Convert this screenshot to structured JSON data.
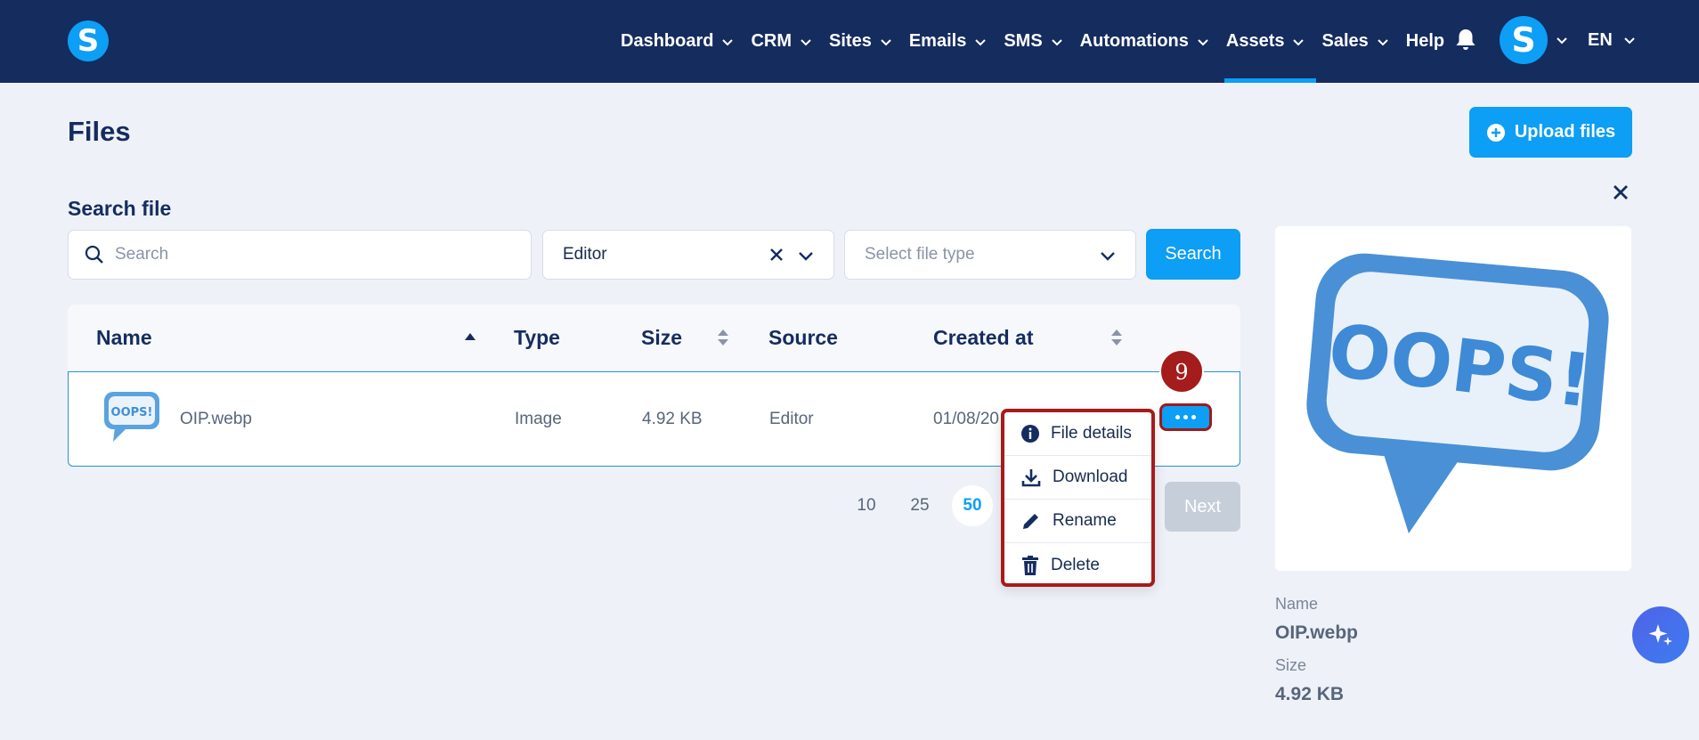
{
  "nav": {
    "logo_letter": "S",
    "items": [
      {
        "label": "Dashboard"
      },
      {
        "label": "CRM"
      },
      {
        "label": "Sites"
      },
      {
        "label": "Emails"
      },
      {
        "label": "SMS"
      },
      {
        "label": "Automations"
      },
      {
        "label": "Assets"
      },
      {
        "label": "Sales"
      }
    ],
    "help": "Help",
    "avatar_letter": "S",
    "language": "EN",
    "active_item": "Assets"
  },
  "page": {
    "title": "Files",
    "upload_label": "Upload files"
  },
  "search": {
    "section_label": "Search file",
    "placeholder": "Search",
    "source_value": "Editor",
    "type_placeholder": "Select file type",
    "button_label": "Search"
  },
  "table": {
    "headers": [
      "Name",
      "Type",
      "Size",
      "Source",
      "Created at"
    ],
    "rows": [
      {
        "name": "OIP.webp",
        "type": "Image",
        "size": "4.92 KB",
        "source": "Editor",
        "created_at": "01/08/20"
      }
    ]
  },
  "pagination": {
    "sizes": [
      "10",
      "25",
      "50"
    ],
    "current": "50",
    "next_label": "Next"
  },
  "row_menu": {
    "items": [
      {
        "label": "File details",
        "icon": "info-icon"
      },
      {
        "label": "Download",
        "icon": "download-icon"
      },
      {
        "label": "Rename",
        "icon": "pencil-icon"
      },
      {
        "label": "Delete",
        "icon": "trash-icon"
      }
    ]
  },
  "annotation": {
    "step_number": "9"
  },
  "preview": {
    "name_label": "Name",
    "name_value": "OIP.webp",
    "size_label": "Size",
    "size_value": "4.92 KB",
    "image_text": "OOPS!"
  },
  "colors": {
    "nav_bg": "#152c5f",
    "accent": "#0d9ef5",
    "annotation": "#a51c1c"
  }
}
